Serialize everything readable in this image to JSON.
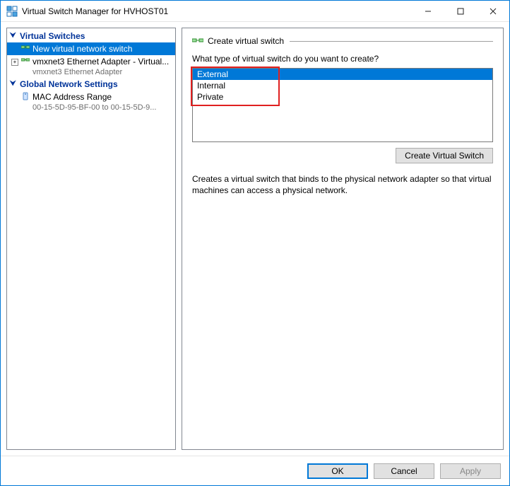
{
  "window": {
    "title": "Virtual Switch Manager for HVHOST01"
  },
  "tree": {
    "section1_title": "Virtual Switches",
    "new_switch_label": "New virtual network switch",
    "adapter_label": "vmxnet3 Ethernet Adapter - Virtual...",
    "adapter_sub": "vmxnet3 Ethernet Adapter",
    "section2_title": "Global Network Settings",
    "mac_label": "MAC Address Range",
    "mac_sub": "00-15-5D-95-BF-00 to 00-15-5D-9..."
  },
  "content": {
    "section_title": "Create virtual switch",
    "prompt": "What type of virtual switch do you want to create?",
    "options": {
      "external": "External",
      "internal": "Internal",
      "private": "Private"
    },
    "create_button": "Create Virtual Switch",
    "description": "Creates a virtual switch that binds to the physical network adapter so that virtual machines can access a physical network."
  },
  "buttons": {
    "ok": "OK",
    "cancel": "Cancel",
    "apply": "Apply"
  }
}
